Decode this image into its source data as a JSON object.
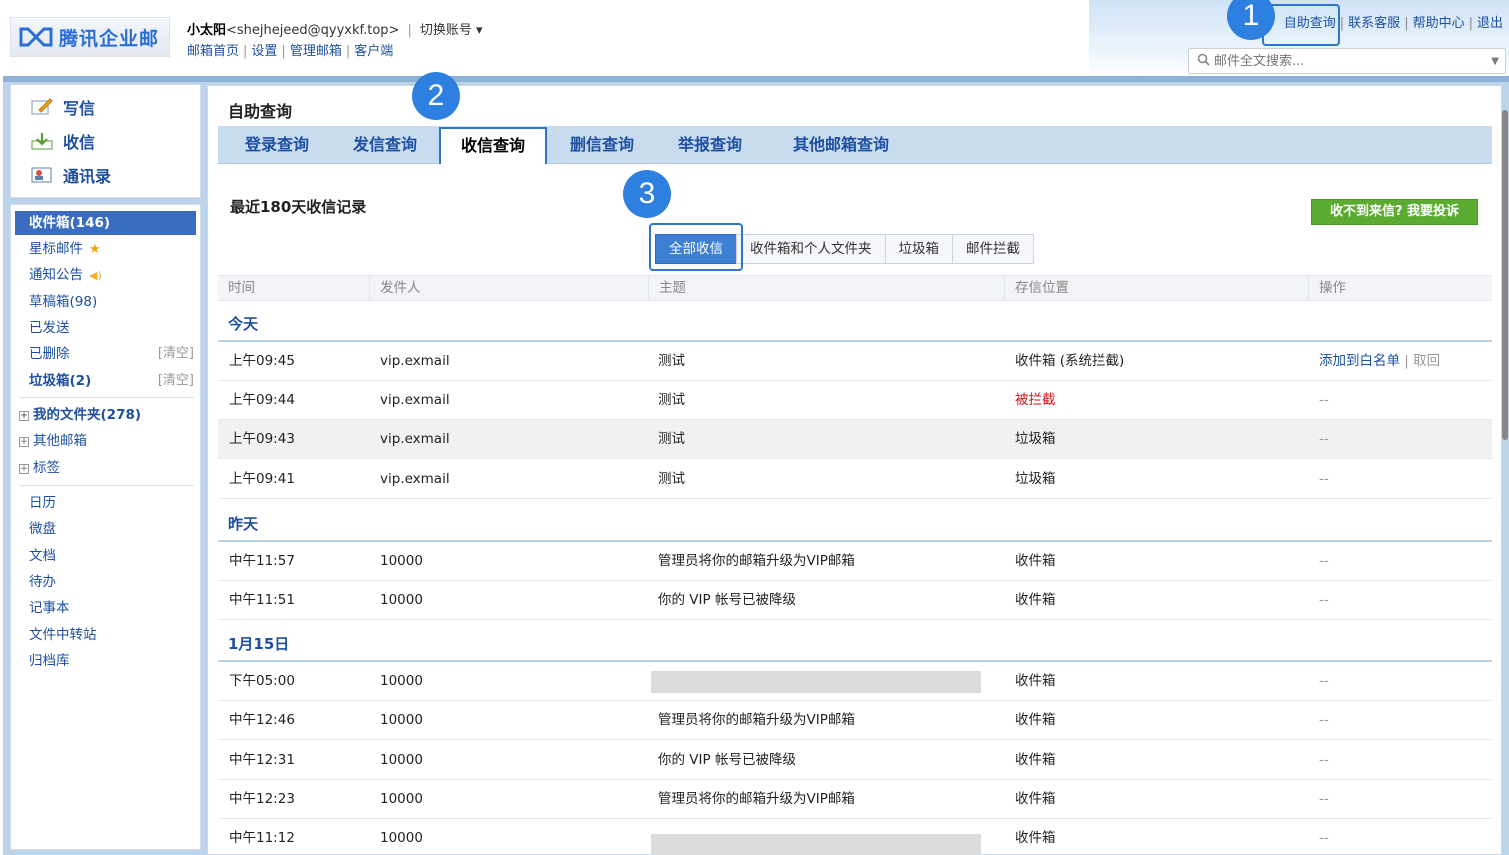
{
  "header": {
    "logo_text": "腾讯企业邮",
    "user_name": "小太阳",
    "user_email": "<shejhejeed@qyyxkf.top>",
    "switch_account": "切换账号",
    "links": [
      "邮箱首页",
      "设置",
      "管理邮箱",
      "客户端"
    ],
    "top_links": [
      "自助查询",
      "联系客服",
      "帮助中心",
      "退出"
    ],
    "search_placeholder": "邮件全文搜索..."
  },
  "sidebar": {
    "actions": [
      "写信",
      "收信",
      "通讯录"
    ],
    "folders": [
      {
        "label": "收件箱(146)",
        "selected": true
      },
      {
        "label": "星标邮件"
      },
      {
        "label": "通知公告"
      },
      {
        "label": "草稿箱(98)"
      },
      {
        "label": "已发送"
      },
      {
        "label": "已删除",
        "action": "[清空]"
      },
      {
        "label": "垃圾箱(2)",
        "action": "[清空]"
      }
    ],
    "groups": [
      "我的文件夹(278)",
      "其他邮箱",
      "标签"
    ],
    "apps": [
      "日历",
      "微盘",
      "文档",
      "待办",
      "记事本",
      "文件中转站",
      "归档库"
    ]
  },
  "main": {
    "title": "自助查询",
    "tabs": [
      "登录查询",
      "发信查询",
      "收信查询",
      "删信查询",
      "举报查询",
      "其他邮箱查询"
    ],
    "active_tab": "收信查询",
    "records_title": "最近180天收信记录",
    "complain_button": "收不到来信? 我要投诉",
    "filters": [
      "全部收信",
      "收件箱和个人文件夹",
      "垃圾箱",
      "邮件拦截"
    ],
    "active_filter": "全部收信",
    "columns": [
      "时间",
      "发件人",
      "主题",
      "存信位置",
      "操作"
    ],
    "groups": [
      {
        "label": "今天",
        "rows": [
          {
            "time": "上午09:45",
            "sender": "vip.exmail",
            "subject": "测试",
            "location": "收件箱 (系统拦截)",
            "op_link": "添加到白名单",
            "op_sep": "|",
            "op_extra": "取回"
          },
          {
            "time": "上午09:44",
            "sender": "vip.exmail",
            "subject": "测试",
            "location": "被拦截",
            "op": "--"
          },
          {
            "time": "上午09:43",
            "sender": "vip.exmail",
            "subject": "测试",
            "location": "垃圾箱",
            "op": "--"
          },
          {
            "time": "上午09:41",
            "sender": "vip.exmail",
            "subject": "测试",
            "location": "垃圾箱",
            "op": "--"
          }
        ]
      },
      {
        "label": "昨天",
        "rows": [
          {
            "time": "中午11:57",
            "sender": "10000",
            "subject": "管理员将你的邮箱升级为VIP邮箱",
            "location": "收件箱",
            "op": "--"
          },
          {
            "time": "中午11:51",
            "sender": "10000",
            "subject": "你的 VIP 帐号已被降级",
            "location": "收件箱",
            "op": "--"
          }
        ]
      },
      {
        "label": "1月15日",
        "rows": [
          {
            "time": "下午05:00",
            "sender": "10000",
            "subject": "",
            "location": "收件箱",
            "op": "--"
          },
          {
            "time": "中午12:46",
            "sender": "10000",
            "subject": "管理员将你的邮箱升级为VIP邮箱",
            "location": "收件箱",
            "op": "--"
          },
          {
            "time": "中午12:31",
            "sender": "10000",
            "subject": "你的 VIP 帐号已被降级",
            "location": "收件箱",
            "op": "--"
          },
          {
            "time": "中午12:23",
            "sender": "10000",
            "subject": "管理员将你的邮箱升级为VIP邮箱",
            "location": "收件箱",
            "op": "--"
          },
          {
            "time": "中午11:12",
            "sender": "10000",
            "subject": "",
            "location": "收件箱",
            "op": "--"
          }
        ]
      }
    ]
  },
  "annotations": [
    "1",
    "2",
    "3"
  ],
  "colors": {
    "accent": "#2d77c9",
    "link": "#1e50a2",
    "complain": "#5aab2f",
    "intercepted": "#d0121b",
    "selected_folder": "#3a6dc0"
  }
}
